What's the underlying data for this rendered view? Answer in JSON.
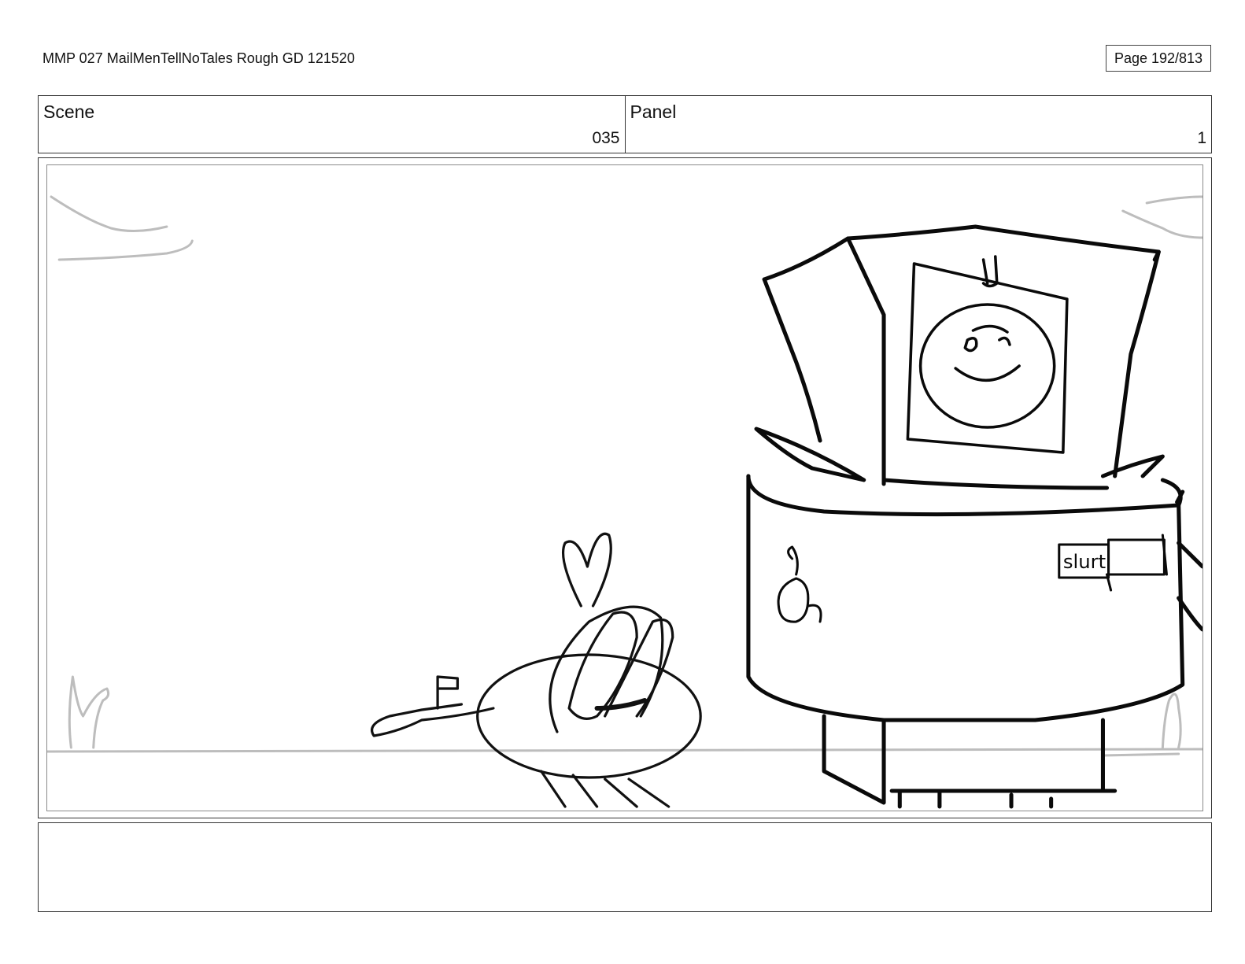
{
  "header": {
    "document_title": "MMP 027 MailMenTellNoTales Rough GD 121520",
    "page_label": "Page 192/813"
  },
  "info": {
    "scene_label": "Scene",
    "scene_value": "035",
    "panel_label": "Panel",
    "panel_value": "1"
  },
  "sketch": {
    "sign_text": "slurt"
  },
  "notes": {
    "text": ""
  }
}
